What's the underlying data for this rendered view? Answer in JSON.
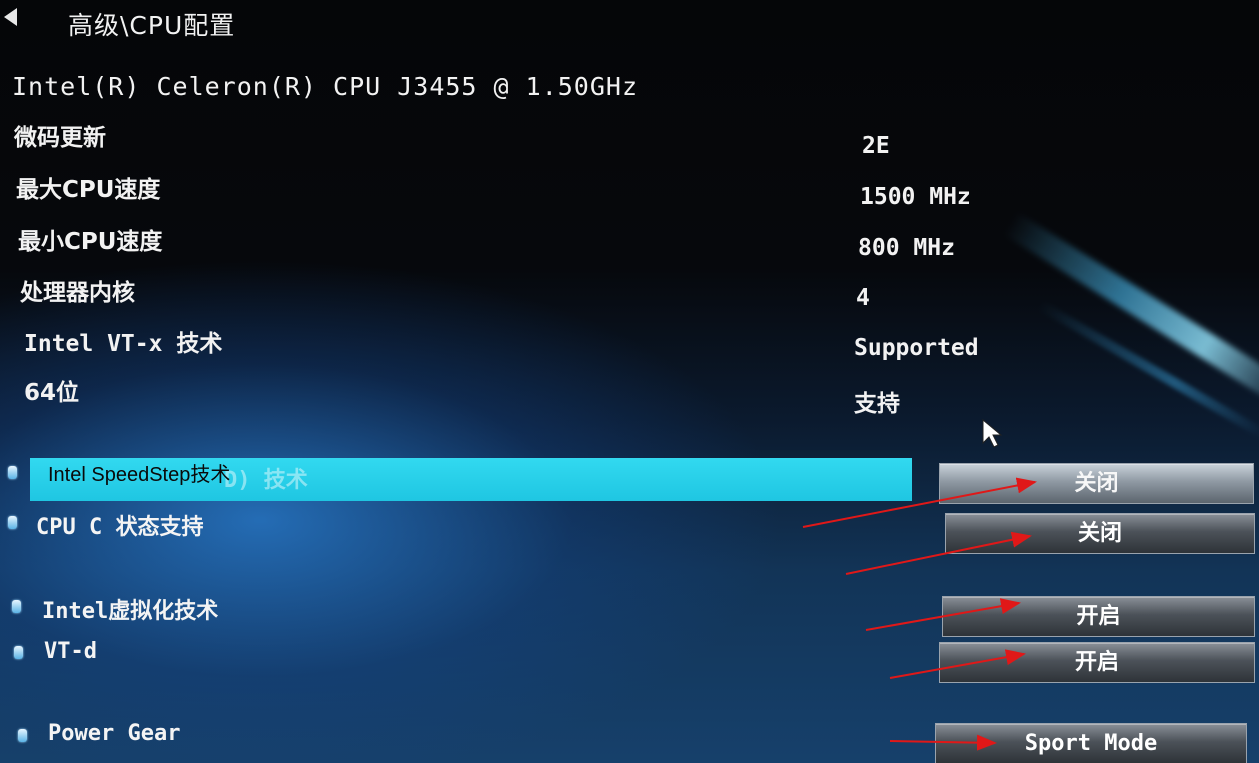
{
  "header": {
    "back_icon": "left-triangle-icon",
    "title": "高级\\CPU配置"
  },
  "cpu_name": "Intel(R) Celeron(R) CPU J3455 @ 1.50GHz",
  "info": {
    "microcode": {
      "label": "微码更新",
      "value": "2E"
    },
    "max_speed": {
      "label": "最大CPU速度",
      "value": "1500 MHz"
    },
    "min_speed": {
      "label": "最小CPU速度",
      "value": "800 MHz"
    },
    "cores": {
      "label": "处理器内核",
      "value": "4"
    },
    "vtx": {
      "label": "Intel VT-x 技术",
      "value": "Supported"
    },
    "bit64": {
      "label": "64位",
      "value": "支持"
    }
  },
  "options": {
    "speedstep": {
      "label": "Intel SpeedStep技术",
      "ghost_text": "D) 技术",
      "value": "关闭"
    },
    "cstate": {
      "label": "CPU C 状态支持",
      "value": "关闭"
    },
    "virtualization": {
      "label": "Intel虚拟化技术",
      "value": "开启"
    },
    "vtd": {
      "label": "VT-d",
      "value": "开启"
    },
    "power_gear": {
      "label": "Power Gear",
      "value": "Sport Mode"
    }
  },
  "colors": {
    "highlight": "#1fc6e2",
    "annotation_arrow": "#e01818",
    "text": "#f2f2f2"
  }
}
